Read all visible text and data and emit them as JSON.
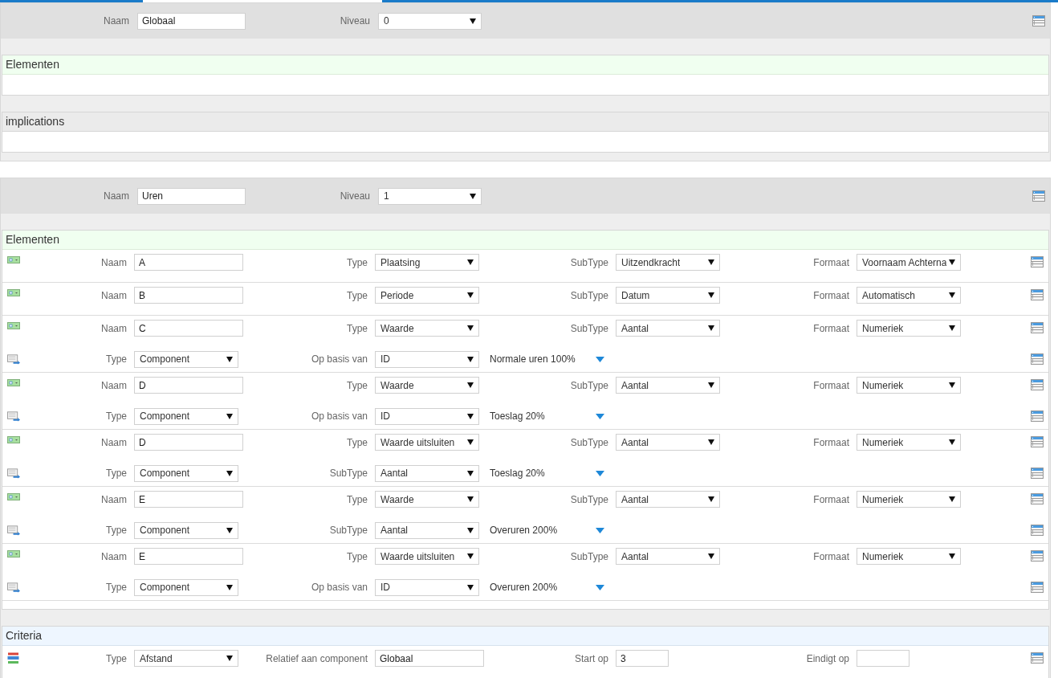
{
  "panels": [
    {
      "header": {
        "fields": [
          {
            "label": "Naam",
            "value": "Globaal",
            "kind": "text"
          },
          {
            "label": "Niveau",
            "value": "0",
            "kind": "select"
          }
        ]
      },
      "sections": [
        {
          "kind": "elements",
          "title": "Elementen"
        },
        {
          "kind": "plain",
          "title": "implications"
        }
      ]
    },
    {
      "header": {
        "fields": [
          {
            "label": "Naam",
            "value": "Uren",
            "kind": "text"
          },
          {
            "label": "Niveau",
            "value": "1",
            "kind": "select"
          }
        ]
      },
      "sections": [
        {
          "kind": "elements",
          "title": "Elementen",
          "items": [
            {
              "fields": [
                {
                  "label": "Naam",
                  "value": "A",
                  "kind": "text"
                },
                {
                  "label": "Type",
                  "value": "Plaatsing",
                  "kind": "select"
                },
                {
                  "label": "SubType",
                  "value": "Uitzendkracht",
                  "kind": "select"
                },
                {
                  "label": "Formaat",
                  "value": "Voornaam Achterna",
                  "kind": "select"
                }
              ]
            },
            {
              "fields": [
                {
                  "label": "Naam",
                  "value": "B",
                  "kind": "text"
                },
                {
                  "label": "Type",
                  "value": "Periode",
                  "kind": "select"
                },
                {
                  "label": "SubType",
                  "value": "Datum",
                  "kind": "select"
                },
                {
                  "label": "Formaat",
                  "value": "Automatisch",
                  "kind": "select"
                }
              ]
            },
            {
              "fields": [
                {
                  "label": "Naam",
                  "value": "C",
                  "kind": "text"
                },
                {
                  "label": "Type",
                  "value": "Waarde",
                  "kind": "select"
                },
                {
                  "label": "SubType",
                  "value": "Aantal",
                  "kind": "select"
                },
                {
                  "label": "Formaat",
                  "value": "Numeriek",
                  "kind": "select"
                }
              ],
              "components": [
                {
                  "fields": [
                    {
                      "label": "Type",
                      "value": "Component",
                      "kind": "select"
                    },
                    {
                      "label": "Op basis van",
                      "value": "ID",
                      "kind": "select"
                    }
                  ],
                  "target": "Normale uren 100%"
                }
              ]
            },
            {
              "fields": [
                {
                  "label": "Naam",
                  "value": "D",
                  "kind": "text"
                },
                {
                  "label": "Type",
                  "value": "Waarde",
                  "kind": "select"
                },
                {
                  "label": "SubType",
                  "value": "Aantal",
                  "kind": "select"
                },
                {
                  "label": "Formaat",
                  "value": "Numeriek",
                  "kind": "select"
                }
              ],
              "components": [
                {
                  "fields": [
                    {
                      "label": "Type",
                      "value": "Component",
                      "kind": "select"
                    },
                    {
                      "label": "Op basis van",
                      "value": "ID",
                      "kind": "select"
                    }
                  ],
                  "target": "Toeslag 20%"
                }
              ]
            },
            {
              "fields": [
                {
                  "label": "Naam",
                  "value": "D",
                  "kind": "text"
                },
                {
                  "label": "Type",
                  "value": "Waarde uitsluiten",
                  "kind": "select"
                },
                {
                  "label": "SubType",
                  "value": "Aantal",
                  "kind": "select"
                },
                {
                  "label": "Formaat",
                  "value": "Numeriek",
                  "kind": "select"
                }
              ],
              "components": [
                {
                  "fields": [
                    {
                      "label": "Type",
                      "value": "Component",
                      "kind": "select"
                    },
                    {
                      "label": "SubType",
                      "value": "Aantal",
                      "kind": "select"
                    }
                  ],
                  "target": "Toeslag 20%"
                }
              ]
            },
            {
              "fields": [
                {
                  "label": "Naam",
                  "value": "E",
                  "kind": "text"
                },
                {
                  "label": "Type",
                  "value": "Waarde",
                  "kind": "select"
                },
                {
                  "label": "SubType",
                  "value": "Aantal",
                  "kind": "select"
                },
                {
                  "label": "Formaat",
                  "value": "Numeriek",
                  "kind": "select"
                }
              ],
              "components": [
                {
                  "fields": [
                    {
                      "label": "Type",
                      "value": "Component",
                      "kind": "select"
                    },
                    {
                      "label": "SubType",
                      "value": "Aantal",
                      "kind": "select"
                    }
                  ],
                  "target": "Overuren 200%"
                }
              ]
            },
            {
              "fields": [
                {
                  "label": "Naam",
                  "value": "E",
                  "kind": "text"
                },
                {
                  "label": "Type",
                  "value": "Waarde uitsluiten",
                  "kind": "select"
                },
                {
                  "label": "SubType",
                  "value": "Aantal",
                  "kind": "select"
                },
                {
                  "label": "Formaat",
                  "value": "Numeriek",
                  "kind": "select"
                }
              ],
              "components": [
                {
                  "fields": [
                    {
                      "label": "Type",
                      "value": "Component",
                      "kind": "select"
                    },
                    {
                      "label": "Op basis van",
                      "value": "ID",
                      "kind": "select"
                    }
                  ],
                  "target": "Overuren 200%"
                }
              ]
            }
          ]
        },
        {
          "kind": "criteria",
          "title": "Criteria",
          "items": [
            {
              "fields": [
                {
                  "label": "Type",
                  "value": "Afstand",
                  "kind": "select"
                },
                {
                  "label": "Relatief aan component",
                  "value": "Globaal",
                  "kind": "text"
                },
                {
                  "label": "Start op",
                  "value": "3",
                  "kind": "short"
                },
                {
                  "label": "Eindigt op",
                  "kind": "short"
                }
              ]
            }
          ]
        }
      ]
    }
  ]
}
